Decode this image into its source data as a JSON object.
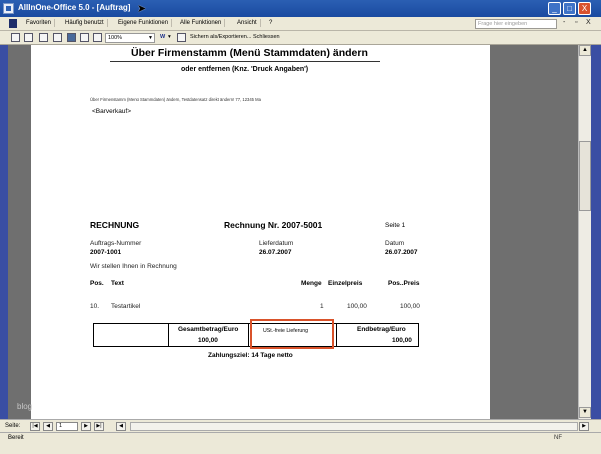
{
  "window": {
    "title": "AllInOne-Office 5.0 - [Auftrag]",
    "controls": {
      "minimize": "_",
      "maximize": "□",
      "close": "X"
    }
  },
  "menu": {
    "items": [
      "Favoriten",
      "Häufig benutzt",
      "Eigene Funktionen",
      "Alle Funktionen",
      "Ansicht",
      "?"
    ],
    "help_placeholder": "Frage hier eingeben",
    "mini_controls": [
      "-",
      "▫",
      "X"
    ]
  },
  "toolbar": {
    "zoom": "100%",
    "export_label": "Sichern als/Exportieren...",
    "close_label": "Schliessen"
  },
  "document": {
    "title": "Über Firmenstamm (Menü Stammdaten) ändern",
    "subtitle": "oder entfernen (Knz. 'Druck Angaben')",
    "small_note": "Über Firmenstamm (Menü Stammdaten) ändern, Testdatensatz direkt ändern! 77, 12345 Ma",
    "company_placeholder": "<Barverkauf>",
    "heading": "RECHNUNG",
    "invoice_number": "Rechnung Nr.  2007-5001",
    "page": "Seite 1",
    "order_label": "Auftrags-Nummer",
    "order_value": "2007-1001",
    "delivery_label": "Lieferdatum",
    "delivery_value": "26.07.2007",
    "date_label": "Datum",
    "date_value": "26.07.2007",
    "intro": "Wir stellen Ihnen in Rechnung",
    "columns": {
      "pos": "Pos.",
      "text": "Text",
      "qty": "Menge",
      "unit": "Einzelpreis",
      "total": "Pos..Preis"
    },
    "items": [
      {
        "pos": "10.",
        "text": "Testartikel",
        "qty": "1",
        "unit": "100,00",
        "total": "100,00"
      }
    ],
    "gross_label": "Gesamtbetrag/Euro",
    "gross_value": "100,00",
    "vat_note": "USt.-freie Lieferung",
    "final_label": "Endbetrag/Euro",
    "final_value": "100,00",
    "payment_terms": "Zahlungsziel: 14 Tage netto",
    "watermark": "blog"
  },
  "navigation": {
    "page_label": "Seite:",
    "page_value": "1"
  },
  "status": {
    "text": "Bereit",
    "indicator": "NF"
  },
  "colors": {
    "titlebar": "#2b5fb3",
    "highlight": "#d9522a",
    "preview_bg": "#6f6f6f"
  }
}
